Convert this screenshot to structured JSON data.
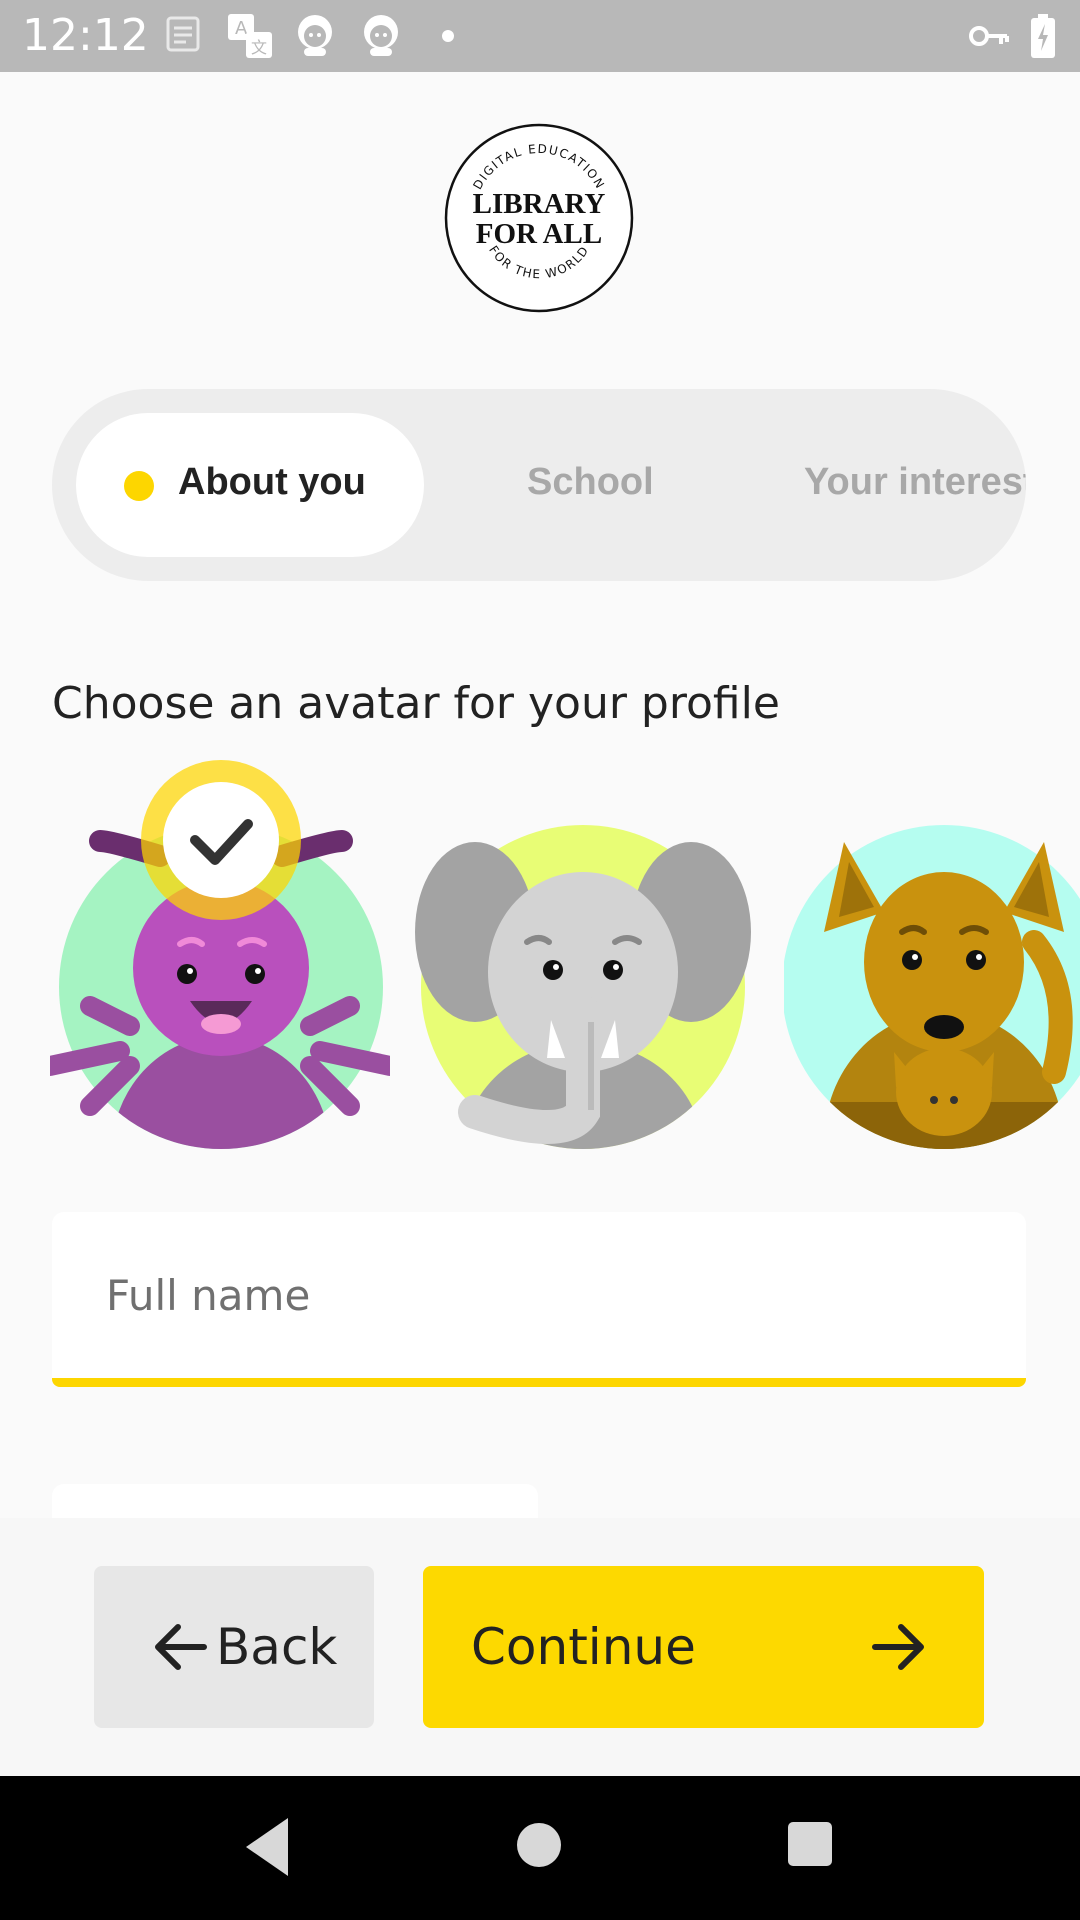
{
  "status_bar": {
    "time": "12:12",
    "icons": [
      "notes-icon",
      "translate-icon",
      "avatar-notification-icon",
      "avatar-notification-icon",
      "dot-icon",
      "vpn-key-icon",
      "battery-charging-icon"
    ]
  },
  "logo": {
    "top_text": "DIGITAL EDUCATION",
    "line1": "LIBRARY",
    "line2": "FOR ALL",
    "bottom_text": "FOR THE WORLD"
  },
  "steps": [
    {
      "label": "About you",
      "active": true
    },
    {
      "label": "School",
      "active": false
    },
    {
      "label": "Your interests",
      "active": false
    }
  ],
  "avatar_section": {
    "heading": "Choose an avatar for your profile",
    "avatars": [
      {
        "name": "spider",
        "selected": true,
        "bg": "#a5f3c2"
      },
      {
        "name": "elephant",
        "selected": false,
        "bg": "#e8fd75"
      },
      {
        "name": "kangaroo",
        "selected": false,
        "bg": "#b5fdf0"
      }
    ]
  },
  "form": {
    "full_name_placeholder": "Full name",
    "full_name_value": ""
  },
  "actions": {
    "back_label": "Back",
    "continue_label": "Continue"
  },
  "colors": {
    "accent": "#fdd900",
    "status_bar": "#b8b8b8"
  }
}
